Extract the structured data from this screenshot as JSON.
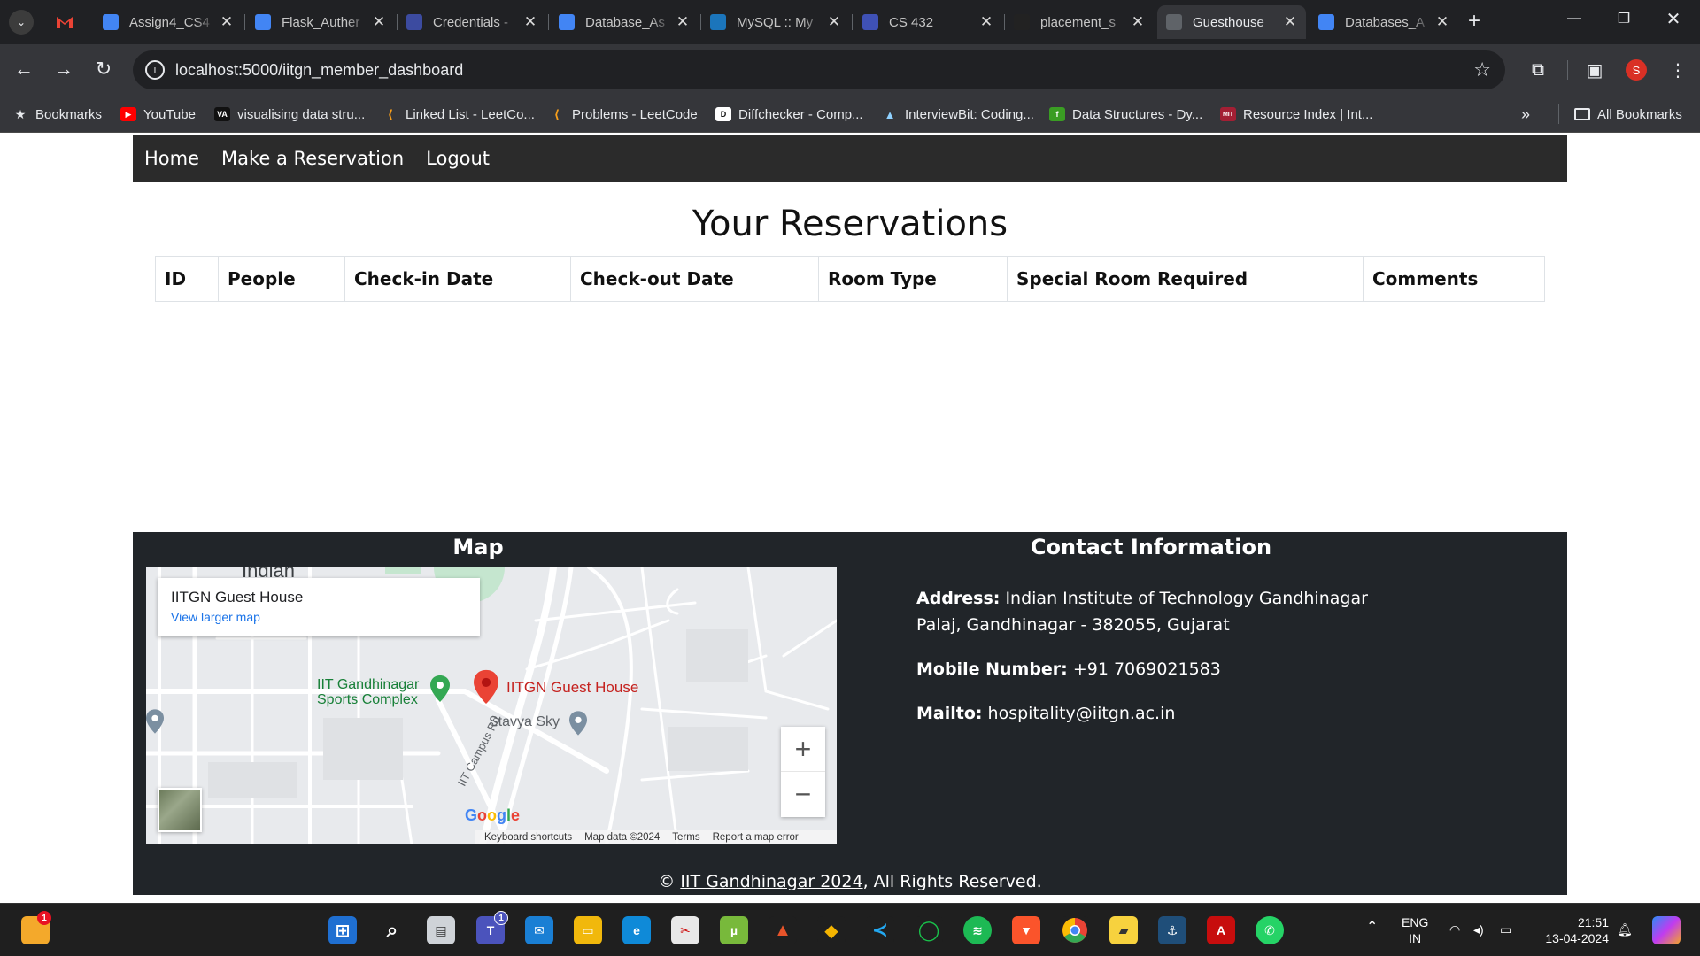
{
  "browser": {
    "tabs": [
      {
        "title": "Assign4_CS4",
        "icon": "docs-icon",
        "color": "#4285f4",
        "active": false
      },
      {
        "title": "Flask_Auther",
        "icon": "docs-icon",
        "color": "#4285f4",
        "active": false
      },
      {
        "title": "Credentials -",
        "icon": "api-icon",
        "color": "#3c4ba0",
        "active": false
      },
      {
        "title": "Database_As",
        "icon": "docs-icon",
        "color": "#4285f4",
        "active": false
      },
      {
        "title": "MySQL :: My",
        "icon": "mysql-icon",
        "color": "#1b75bb",
        "active": false
      },
      {
        "title": "CS 432",
        "icon": "forms-icon",
        "color": "#3f51b5",
        "active": false
      },
      {
        "title": "placement_s",
        "icon": "github-icon",
        "color": "#222222",
        "active": false
      },
      {
        "title": "Guesthouse",
        "icon": "globe-icon",
        "color": "#5f6368",
        "active": true
      },
      {
        "title": "Databases_A",
        "icon": "docs-icon",
        "color": "#4285f4",
        "active": false
      }
    ],
    "url": "localhost:5000/iitgn_member_dashboard",
    "profile_initial": "S",
    "bookmarks": [
      {
        "label": "Bookmarks",
        "icon": "star-icon"
      },
      {
        "label": "YouTube",
        "icon": "youtube-icon"
      },
      {
        "label": "visualising data stru...",
        "icon": "va-icon"
      },
      {
        "label": "Linked List - LeetCo...",
        "icon": "leetcode-icon"
      },
      {
        "label": "Problems - LeetCode",
        "icon": "leetcode-icon"
      },
      {
        "label": "Diffchecker - Comp...",
        "icon": "diffchecker-icon"
      },
      {
        "label": "InterviewBit: Coding...",
        "icon": "interviewbit-icon"
      },
      {
        "label": "Data Structures - Dy...",
        "icon": "ds-icon"
      },
      {
        "label": "Resource Index | Int...",
        "icon": "mit-icon"
      }
    ],
    "all_bookmarks": "All Bookmarks"
  },
  "nav": {
    "home": "Home",
    "reserve": "Make a Reservation",
    "logout": "Logout"
  },
  "page_title": "Your Reservations",
  "table": {
    "columns": [
      "ID",
      "People",
      "Check-in Date",
      "Check-out Date",
      "Room Type",
      "Special Room Required",
      "Comments"
    ],
    "rows": []
  },
  "footer": {
    "map_title": "Map",
    "contact_title": "Contact Information",
    "map": {
      "place_name": "IITGN Guest House",
      "larger_map": "View larger map",
      "marker_label": "IITGN Guest House",
      "sports_label": "IIT Gandhinagar Sports Complex",
      "stavya_label": "Stavya Sky",
      "road_label": "IIT Campus Rd",
      "area_label": "Indian",
      "google": "Google",
      "keyboard": "Keyboard shortcuts",
      "mapdata": "Map data ©2024",
      "terms": "Terms",
      "report": "Report a map error"
    },
    "address_label": "Address:",
    "address_line1": "Indian Institute of Technology Gandhinagar",
    "address_line2": "Palaj, Gandhinagar - 382055, Gujarat",
    "mobile_label": "Mobile Number:",
    "mobile": "+91 7069021583",
    "mail_label": "Mailto:",
    "mail": "hospitality@iitgn.ac.in",
    "copyright_symbol": "©",
    "copyright_link": "IIT Gandhinagar 2024",
    "copyright_rest": ", All Rights Reserved."
  },
  "taskbar": {
    "lang_top": "ENG",
    "lang_bottom": "IN",
    "time": "21:51",
    "date": "13-04-2024",
    "weather_badge": "1",
    "teams_badge": "1"
  }
}
